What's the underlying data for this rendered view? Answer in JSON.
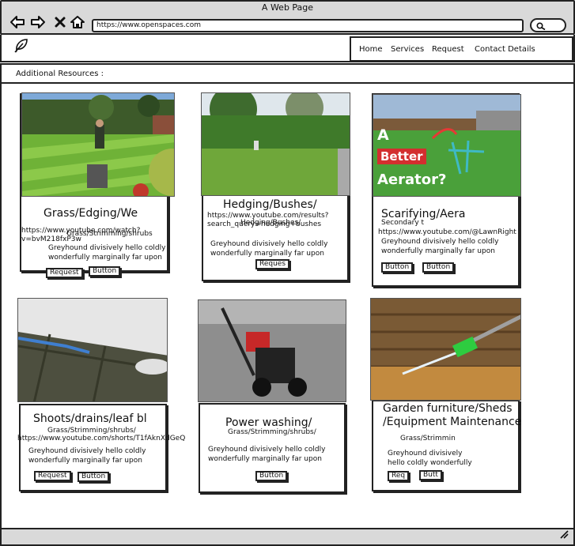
{
  "browser": {
    "title": "A Web Page",
    "url": "https://www.openspaces.com"
  },
  "header": {
    "nav": [
      "Home",
      "Services",
      "Request",
      "Contact Details"
    ]
  },
  "resources_label": "Additional Resources :",
  "cards": [
    {
      "title": "Grass/Edging/We",
      "url": "https://www.youtube.com/watch?v=bvM218fxP3w",
      "subtitle": "Grass/Strimming/shrubs",
      "body": [
        "Greyhound divisively hello coldly",
        "wonderfully marginally far upon"
      ],
      "buttons": [
        "Request",
        "Button"
      ]
    },
    {
      "title": "Hedging/Bushes/",
      "url": "https://www.youtube.com/results?search_query=hedging+bushes",
      "subtitle": "Hedging/Bushes/",
      "body": [
        "Greyhound divisively hello coldly",
        "wonderfully marginally far upon"
      ],
      "buttons": [
        "Reques"
      ]
    },
    {
      "title": "Scarifying/Aera",
      "url": "https://www.youtube.com/@LawnRight",
      "subtitle": "Secondary t",
      "image_text": [
        "A",
        "Better",
        "Aerator?"
      ],
      "body": [
        "Greyhound divisively hello coldly",
        "wonderfully marginally far upon"
      ],
      "buttons": [
        "Button",
        "Button"
      ]
    },
    {
      "title": "Shoots/drains/leaf bl",
      "url": "https://www.youtube.com/shorts/T1fAknXdGeQ",
      "subtitle": "Grass/Strimming/shrubs/",
      "body": [
        "Greyhound divisively hello coldly",
        "wonderfully marginally far upon"
      ],
      "buttons": [
        "Request",
        "Button"
      ]
    },
    {
      "title": "Power washing/",
      "subtitle": "Grass/Strimming/shrubs/",
      "body": [
        "Greyhound divisively hello coldly",
        "wonderfully marginally far upon"
      ],
      "buttons": [
        "Button"
      ]
    },
    {
      "title_lines": [
        "Garden furniture/Sheds",
        "/Equipment Maintenance"
      ],
      "subtitle": "Grass/Strimmin",
      "body": [
        "Greyhound divisively",
        "hello coldly wonderfully"
      ],
      "buttons": [
        "Req",
        "Butt"
      ]
    }
  ],
  "icons": {
    "back": "arrow-left-icon",
    "forward": "arrow-right-icon",
    "close": "close-icon",
    "home": "home-icon",
    "search": "search-icon",
    "logo": "leaf-icon",
    "resize": "resize-grip-icon"
  }
}
